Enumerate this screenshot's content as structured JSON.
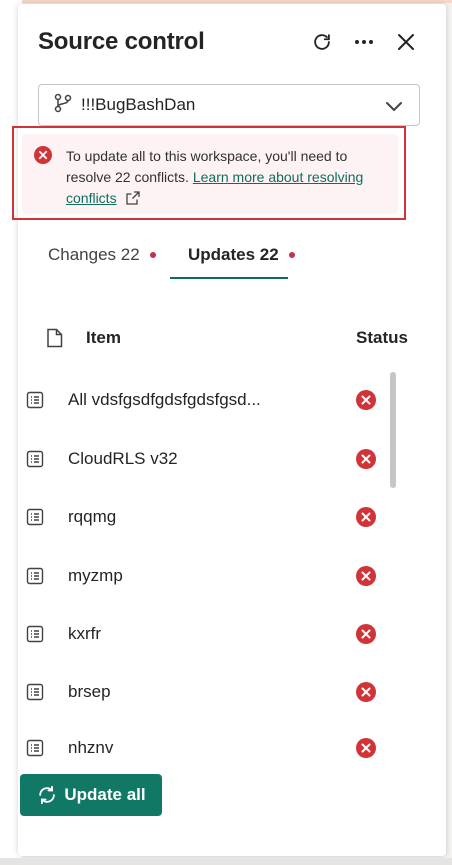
{
  "panel": {
    "title": "Source control",
    "icons": {
      "refresh": "refresh-icon",
      "more": "more-icon",
      "close": "close-icon"
    }
  },
  "branch": {
    "name": "!!!BugBashDan",
    "icon": "branch-icon"
  },
  "alert": {
    "message": "To update all to this workspace, you'll need to resolve 22 conflicts.",
    "link_text": "Learn more about resolving conflicts",
    "color": "#d13438"
  },
  "tabs": [
    {
      "label": "Changes 22",
      "active": false
    },
    {
      "label": "Updates 22",
      "active": true
    }
  ],
  "table": {
    "headers": {
      "item": "Item",
      "status": "Status"
    },
    "rows": [
      {
        "name": "All vdsfgsdfgdsfgdsfgsd...",
        "status": "conflict"
      },
      {
        "name": "CloudRLS v32",
        "status": "conflict"
      },
      {
        "name": "rqqmg",
        "status": "conflict"
      },
      {
        "name": "myzmp",
        "status": "conflict"
      },
      {
        "name": "kxrfr",
        "status": "conflict"
      },
      {
        "name": "brsep",
        "status": "conflict"
      },
      {
        "name": "nhznv",
        "status": "conflict"
      }
    ]
  },
  "update_button": {
    "label": "Update all"
  },
  "colors": {
    "accent": "#117865",
    "error": "#d13438",
    "dot": "#c4314b"
  }
}
